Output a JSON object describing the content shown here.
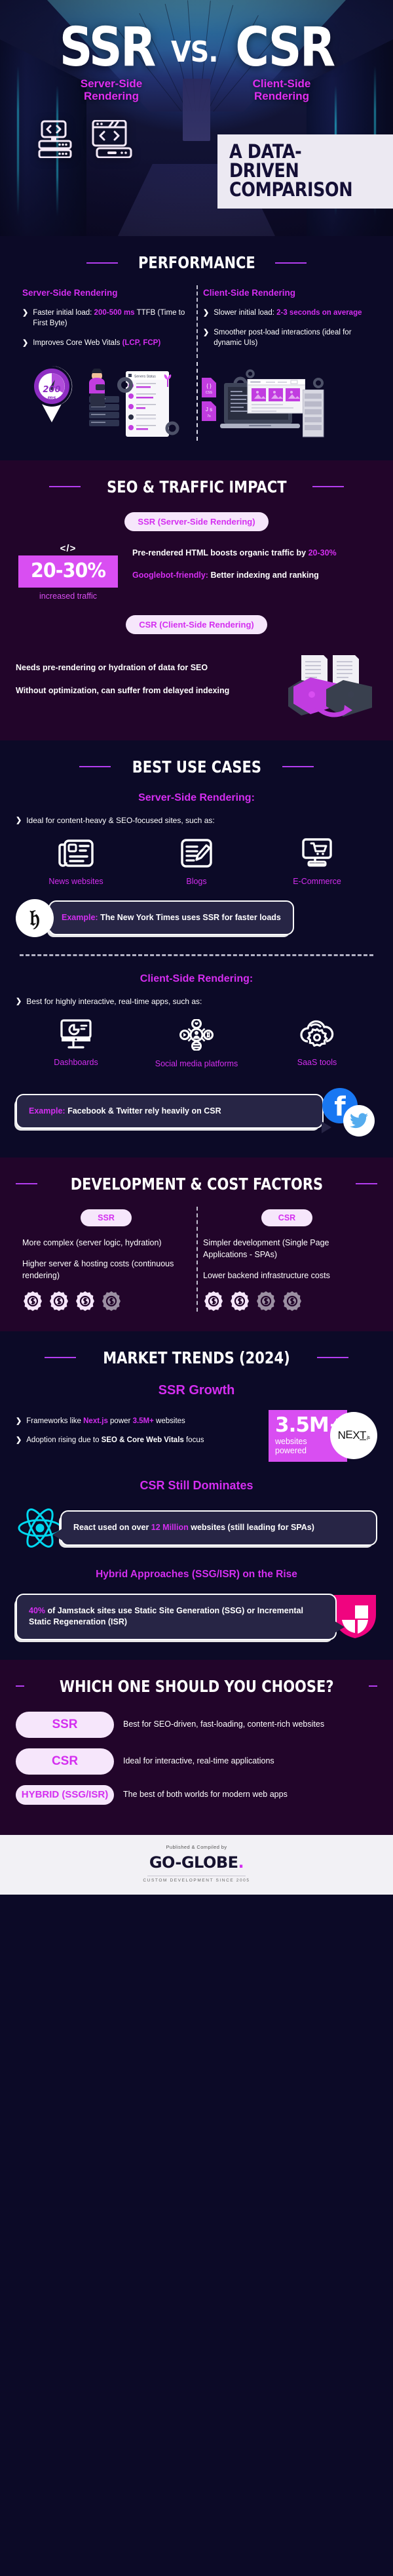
{
  "hero": {
    "left_title": "SSR",
    "vs": "VS.",
    "right_title": "CSR",
    "left_subtitle": "Server-Side Rendering",
    "right_subtitle": "Client-Side Rendering",
    "badge_line1": "A DATA-DRIVEN",
    "badge_line2": "COMPARISON"
  },
  "performance": {
    "heading": "PERFORMANCE",
    "ssr_head": "Server-Side Rendering",
    "csr_head": "Client-Side Rendering",
    "ssr_bullets": [
      {
        "pre": "Faster initial load: ",
        "hl": "200-500 ms",
        "post": " TTFB (Time to First Byte)"
      },
      {
        "pre": "Improves Core Web Vitals ",
        "hl": "(LCP, FCP)",
        "post": ""
      }
    ],
    "csr_bullets": [
      {
        "pre": "Slower initial load: ",
        "hl": "2-3 seconds on average",
        "post": ""
      },
      {
        "pre": "Smoother post-load interactions (ideal for dynamic UIs)",
        "hl": "",
        "post": ""
      }
    ],
    "gauge_value": "200",
    "gauge_unit": "ms",
    "server_status_title": "Servers Status",
    "css_label": "CSS",
    "js_label": "JS",
    "js_time": "7s"
  },
  "seo": {
    "heading": "SEO & TRAFFIC IMPACT",
    "ssr_pill": "SSR (Server-Side Rendering)",
    "code_icon": "</>",
    "stat_big": "20-30%",
    "stat_caption": "increased traffic",
    "ssr_points": [
      {
        "pre": "Pre-rendered HTML boosts organic traffic by ",
        "hl": "20-30%",
        "post": ""
      },
      {
        "pre": "",
        "hl": "Googlebot-friendly:",
        "post": " Better indexing and ranking"
      }
    ],
    "csr_pill": "CSR (Client-Side Rendering)",
    "csr_points": [
      "Needs pre-rendering or hydration of data for SEO",
      "Without optimization, can suffer from delayed indexing"
    ]
  },
  "use_cases": {
    "heading": "BEST USE CASES",
    "ssr_subhead": "Server-Side Rendering:",
    "ssr_lead": "Ideal for content-heavy & SEO-focused sites, such as:",
    "ssr_items": [
      {
        "label": "News websites",
        "icon": "newspaper-icon"
      },
      {
        "label": "Blogs",
        "icon": "blog-edit-icon"
      },
      {
        "label": "E-Commerce",
        "icon": "shopping-cart-monitor-icon"
      }
    ],
    "ssr_example_label": "Example:",
    "ssr_example_text": " The New York Times uses SSR for faster loads",
    "ssr_example_logo": "new-york-times-logo",
    "csr_subhead": "Client-Side Rendering:",
    "csr_lead": "Best for highly interactive, real-time apps, such as:",
    "csr_items": [
      {
        "label": "Dashboards",
        "icon": "dashboard-monitor-icon"
      },
      {
        "label": "Social media platforms",
        "icon": "social-network-icon"
      },
      {
        "label": "SaaS tools",
        "icon": "cloud-gear-icon"
      }
    ],
    "csr_example_label": "Example:",
    "csr_example_text": " Facebook & Twitter rely heavily on CSR",
    "csr_example_logos": [
      "facebook-logo",
      "twitter-logo"
    ]
  },
  "dev_cost": {
    "heading": "DEVELOPMENT & COST FACTORS",
    "ssr_pill": "SSR",
    "csr_pill": "CSR",
    "ssr_points": [
      "More complex (server logic, hydration)",
      "Higher server & hosting costs (continuous rendering)"
    ],
    "csr_points": [
      "Simpler development (Single Page Applications - SPAs)",
      "Lower backend infrastructure costs"
    ],
    "ssr_cost_filled": 3,
    "ssr_cost_total": 4,
    "csr_cost_filled": 2,
    "csr_cost_total": 4
  },
  "market": {
    "heading": "MARKET TRENDS (2024)",
    "ssr_growth_title": "SSR Growth",
    "ssr_bullets": [
      {
        "pre": "Frameworks like ",
        "hl": "Next.js",
        "post": " power ",
        "hl2": "3.5M+",
        "post2": " websites"
      },
      {
        "pre": "Adoption rising due to ",
        "hl": "SEO & Core Web Vitals",
        "post": " focus"
      }
    ],
    "next_stat": "3.5M+",
    "next_stat_caption": "websites powered",
    "next_logo": "NEXT",
    "next_logo_suffix": ".js",
    "csr_title": "CSR Still Dominates",
    "react_pre": "React used on over ",
    "react_hl": "12 Million",
    "react_post": " websites (still leading for SPAs)",
    "react_logo": "react-logo",
    "hybrid_title": "Hybrid Approaches (SSG/ISR) on the Rise",
    "hybrid_hl": "40%",
    "hybrid_text": " of Jamstack sites use Static Site Generation (SSG) or Incremental Static Regeneration (ISR)",
    "hybrid_bold": "Jamstack",
    "hybrid_logo": "jamstack-logo"
  },
  "choose": {
    "heading": "WHICH ONE SHOULD YOU CHOOSE?",
    "rows": [
      {
        "pill": "SSR",
        "desc": "Best for SEO-driven, fast-loading, content-rich websites"
      },
      {
        "pill": "CSR",
        "desc": "Ideal for interactive, real-time applications"
      },
      {
        "pill": "HYBRID (SSG/ISR)",
        "desc": "The best of both worlds for modern web apps"
      }
    ]
  },
  "footer": {
    "published_by": "Published & Compiled by",
    "brand": "GO-GLOBE",
    "brand_dot": ".",
    "tagline": "CUSTOM DEVELOPMENT SINCE 2005"
  },
  "colors": {
    "magenta": "#d42ef0",
    "dark_navy": "#0c0a27",
    "plum": "#22052a",
    "cream": "#f6e6fb"
  }
}
